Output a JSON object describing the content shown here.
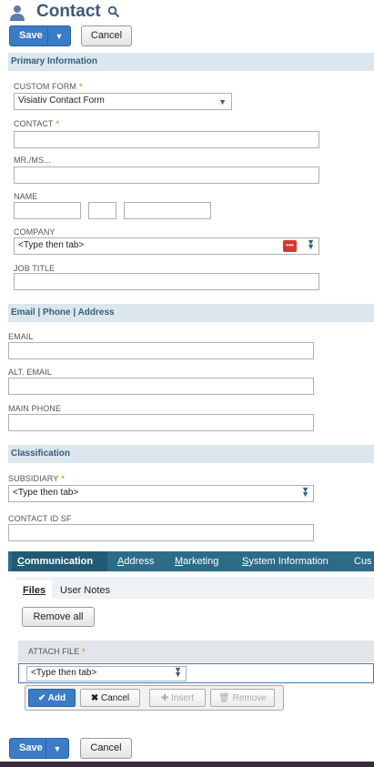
{
  "header": {
    "title": "Contact",
    "icon": "person-icon",
    "search_icon": "search-icon"
  },
  "toolbar": {
    "save_label": "Save",
    "cancel_label": "Cancel"
  },
  "primary": {
    "title": "Primary Information",
    "custom_form": {
      "label": "CUSTOM FORM",
      "value": "Visiativ Contact Form"
    },
    "contact": {
      "label": "CONTACT",
      "value": ""
    },
    "salutation": {
      "label": "MR./MS...",
      "value": ""
    },
    "name": {
      "label": "NAME"
    },
    "company": {
      "label": "COMPANY",
      "placeholder": "<Type then tab>"
    },
    "job_title": {
      "label": "JOB TITLE",
      "value": ""
    }
  },
  "email_section": {
    "title": "Email | Phone | Address",
    "email": {
      "label": "EMAIL"
    },
    "alt_email": {
      "label": "ALT. EMAIL"
    },
    "main_phone": {
      "label": "MAIN PHONE"
    }
  },
  "classification": {
    "title": "Classification",
    "subsidiary": {
      "label": "SUBSIDIARY",
      "placeholder": "<Type then tab>"
    },
    "contact_id_sf": {
      "label": "CONTACT ID SF"
    }
  },
  "tabs": [
    {
      "first": "C",
      "rest": "ommunication"
    },
    {
      "first": "A",
      "rest": "ddress"
    },
    {
      "first": "M",
      "rest": "arketing"
    },
    {
      "first": "S",
      "rest": "ystem Information"
    },
    {
      "first": "",
      "rest": "Cus"
    }
  ],
  "subtabs": {
    "files": "Files",
    "user_notes": "User Notes"
  },
  "files": {
    "remove_all": "Remove all",
    "attach_label": "ATTACH FILE",
    "attach_placeholder": "<Type then tab>",
    "add": "Add",
    "cancel": "Cancel",
    "insert": "Insert",
    "remove": "Remove"
  },
  "colors": {
    "accent": "#3a7cc7",
    "section_bg": "#dbe6ee",
    "tab_bar": "#2d6c88",
    "required": "#e8a23a"
  }
}
